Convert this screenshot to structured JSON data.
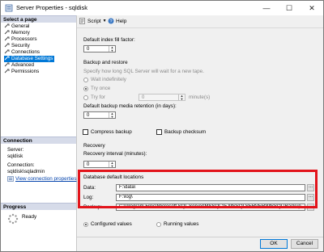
{
  "window": {
    "title": "Server Properties - sqldisk",
    "minimize": "—",
    "maximize": "☐",
    "close": "✕"
  },
  "left": {
    "select_page_header": "Select a page",
    "pages": [
      {
        "label": "General",
        "selected": false
      },
      {
        "label": "Memory",
        "selected": false
      },
      {
        "label": "Processors",
        "selected": false
      },
      {
        "label": "Security",
        "selected": false
      },
      {
        "label": "Connections",
        "selected": false
      },
      {
        "label": "Database Settings",
        "selected": true
      },
      {
        "label": "Advanced",
        "selected": false
      },
      {
        "label": "Permissions",
        "selected": false
      }
    ],
    "connection_header": "Connection",
    "server_label": "Server:",
    "server_value": "sqldisk",
    "connection_label": "Connection:",
    "connection_value": "sqldisk\\sqladmin",
    "view_link": "View connection properties",
    "progress_header": "Progress",
    "progress_status": "Ready"
  },
  "toolbar": {
    "script": "Script",
    "help": "Help"
  },
  "settings": {
    "index_fill_label": "Default index fill factor:",
    "index_fill_value": "0",
    "backup_restore_label": "Backup and restore",
    "backup_desc": "Specify how long SQL Server will wait for a new tape.",
    "wait_indefinitely": "Wait indefinitely",
    "try_once": "Try once",
    "try_for": "Try for",
    "try_for_value": "0",
    "minutes_label": "minute(s)",
    "retention_label": "Default backup media retention (in days):",
    "retention_value": "0",
    "compress_backup": "Compress backup",
    "backup_checksum": "Backup checksum",
    "recovery_label": "Recovery",
    "recovery_interval_label": "Recovery interval (minutes):",
    "recovery_interval_value": "0",
    "db_locations_label": "Database default locations",
    "data_label": "Data:",
    "data_value": "F:\\data\\",
    "log_label": "Log:",
    "log_value": "F:\\log\\",
    "backup_label": "Backup:",
    "backup_value": "C:\\Program Files\\Microsoft SQL Server\\MSSQL15.MSSQLSERVER\\MSSQL\\Backup",
    "browse": "..."
  },
  "values_mode": {
    "configured": "Configured values",
    "running": "Running values"
  },
  "buttons": {
    "ok": "OK",
    "cancel": "Cancel"
  },
  "colors": {
    "highlight_box": "#e2141b",
    "selected_page": "#0078d7"
  }
}
